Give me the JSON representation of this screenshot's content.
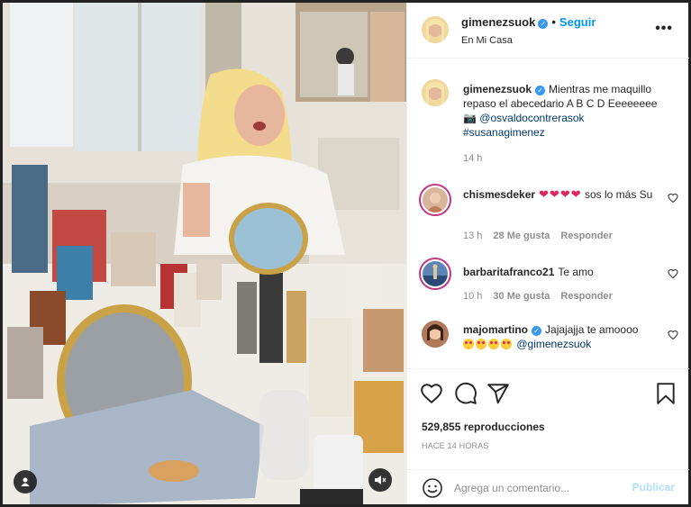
{
  "post": {
    "author": "gimenezsuok",
    "follow_label": "Seguir",
    "location": "En Mi Casa",
    "more_label": "•••"
  },
  "caption": {
    "user": "gimenezsuok",
    "text": "Mientras me maquillo repaso el abecedario A B C D Eeeeeeee",
    "camera": "📷",
    "mention": "@osvaldocontrerasok",
    "hashtag": "#susanagimenez",
    "time": "14 h"
  },
  "comments": [
    {
      "user": "chismesdeker",
      "hearts": "❤❤❤❤",
      "text": "sos lo más Su",
      "time": "13 h",
      "likes": "28 Me gusta",
      "reply": "Responder"
    },
    {
      "user": "barbaritafranco21",
      "hearts": "",
      "text": "Te amo",
      "time": "10 h",
      "likes": "30 Me gusta",
      "reply": "Responder"
    },
    {
      "user": "majomartino",
      "hearts": "",
      "text": "Jajajajja te amoooo",
      "mention": "@gimenezsuok",
      "time": "",
      "likes": "",
      "reply": ""
    }
  ],
  "stats": {
    "views": "529,855 reproducciones",
    "posted_ago": "HACE 14 HORAS"
  },
  "composer": {
    "placeholder": "Agrega un comentario...",
    "post_label": "Publicar"
  },
  "colors": {
    "accent": "#0095f6",
    "heart": "#e0245e",
    "story_ring": "#c13584",
    "disabled_post": "#b2dffc"
  },
  "icons": [
    "heart-icon",
    "comment-icon",
    "share-icon",
    "bookmark-icon",
    "smile-icon",
    "mute-icon",
    "profile-icon",
    "verified-icon",
    "more-icon"
  ]
}
